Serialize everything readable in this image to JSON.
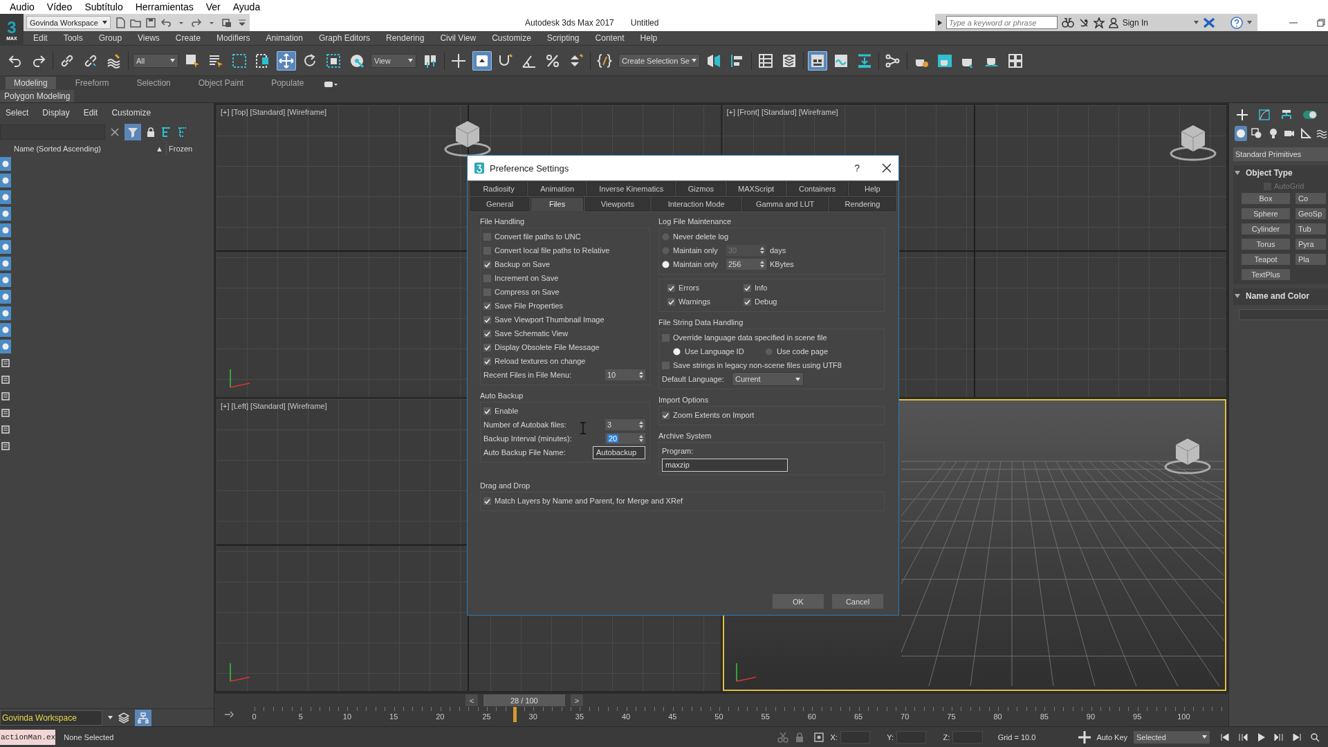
{
  "os_menu": [
    "Audio",
    "Vídeo",
    "Subtítulo",
    "Herramientas",
    "Ver",
    "Ayuda"
  ],
  "title_bar": {
    "logo_mark": "3",
    "logo_label": "MAX",
    "workspace": "Govinda Workspace",
    "app_title": "Autodesk 3ds Max 2017",
    "document": "Untitled",
    "search": {
      "placeholder": "Type a keyword or phrase"
    },
    "sign_in": "Sign In"
  },
  "menu_bar": [
    "Edit",
    "Tools",
    "Group",
    "Views",
    "Create",
    "Modifiers",
    "Animation",
    "Graph Editors",
    "Rendering",
    "Civil View",
    "Customize",
    "Scripting",
    "Content",
    "Help"
  ],
  "main_toolbar": {
    "selection_filter": "All",
    "reference_coordinate": "View",
    "named_selection": "Create Selection Se",
    "buttons": [
      {
        "selected": false
      },
      {
        "selected": false
      },
      {
        "selected": false
      },
      {
        "selected": false
      },
      {
        "selected": false
      },
      {
        "selected": false
      },
      {
        "selected": false
      },
      {
        "selected": false
      },
      {
        "selected": false
      },
      {
        "selected": true
      },
      {
        "selected": false
      },
      {
        "selected": false
      },
      {
        "selected": false
      },
      {
        "selected": false
      },
      {
        "selected": false
      },
      {
        "selected": true
      },
      {
        "selected": false
      },
      {
        "selected": false
      },
      {
        "selected": false
      },
      {
        "selected": false
      },
      {
        "selected": false
      },
      {
        "selected": false
      },
      {
        "selected": false
      },
      {
        "selected": false
      },
      {
        "selected": false
      },
      {
        "selected": true
      },
      {
        "selected": false
      },
      {
        "selected": false
      },
      {
        "selected": false
      },
      {
        "selected": false
      },
      {
        "selected": false
      },
      {
        "selected": false
      },
      {
        "selected": false
      },
      {
        "selected": false
      }
    ]
  },
  "ribbon": {
    "tabs": [
      {
        "label": "Modeling",
        "selected": true
      },
      {
        "label": "Freeform",
        "selected": false
      },
      {
        "label": "Selection",
        "selected": false
      },
      {
        "label": "Object Paint",
        "selected": false
      },
      {
        "label": "Populate",
        "selected": false
      }
    ],
    "panel": "Polygon Modeling"
  },
  "scene_explorer": {
    "menu": [
      "Select",
      "Display",
      "Edit",
      "Customize"
    ],
    "columns": [
      "Name (Sorted Ascending)",
      "Frozen"
    ],
    "sort_mark": "▲",
    "filters": [
      {
        "on": true
      },
      {
        "on": true
      },
      {
        "on": true
      },
      {
        "on": true
      },
      {
        "on": true
      },
      {
        "on": true
      },
      {
        "on": true
      },
      {
        "on": true
      },
      {
        "on": true
      },
      {
        "on": true
      },
      {
        "on": true
      },
      {
        "on": true
      },
      {
        "on": false
      },
      {
        "on": false
      },
      {
        "on": false
      },
      {
        "on": false
      },
      {
        "on": false
      },
      {
        "on": false
      }
    ],
    "workspace": "Govinda Workspace"
  },
  "viewports": [
    {
      "label": "[+] [Top] [Standard] [Wireframe]",
      "active": false
    },
    {
      "label": "[+] [Front] [Standard] [Wireframe]",
      "active": false
    },
    {
      "label": "[+] [Left] [Standard] [Wireframe]",
      "active": false
    },
    {
      "active": true
    }
  ],
  "dialog": {
    "title": "Preference Settings",
    "help": "?",
    "tab_rows": [
      [
        {
          "label": "Radiosity",
          "selected": false
        },
        {
          "label": "Animation",
          "selected": false
        },
        {
          "label": "Inverse Kinematics",
          "selected": false
        },
        {
          "label": "Gizmos",
          "selected": false
        },
        {
          "label": "MAXScript",
          "selected": false
        },
        {
          "label": "Containers",
          "selected": false
        },
        {
          "label": "Help",
          "selected": false
        }
      ],
      [
        {
          "label": "General",
          "selected": false
        },
        {
          "label": "Files",
          "selected": true
        },
        {
          "label": "Viewports",
          "selected": false
        },
        {
          "label": "Interaction Mode",
          "selected": false
        },
        {
          "label": "Gamma and LUT",
          "selected": false
        },
        {
          "label": "Rendering",
          "selected": false
        }
      ]
    ],
    "file_handling": {
      "title": "File Handling",
      "items": [
        {
          "label": "Convert file paths to UNC",
          "checked": false
        },
        {
          "label": "Convert local file paths to Relative",
          "checked": false
        },
        {
          "label": "Backup on Save",
          "checked": true
        },
        {
          "label": "Increment on Save",
          "checked": false
        },
        {
          "label": "Compress on Save",
          "checked": false
        },
        {
          "label": "Save File Properties",
          "checked": true
        },
        {
          "label": "Save Viewport Thumbnail Image",
          "checked": true
        },
        {
          "label": "Save Schematic View",
          "checked": true
        },
        {
          "label": "Display Obsolete File Message",
          "checked": true
        },
        {
          "label": "Reload textures on change",
          "checked": true
        }
      ],
      "recent_files": {
        "label": "Recent Files in File Menu:",
        "value": "10"
      }
    },
    "auto_backup": {
      "title": "Auto Backup",
      "enable": {
        "label": "Enable",
        "checked": true
      },
      "fields": [
        {
          "kind": "spinner",
          "label": "Number of Autobak files:",
          "value": "3",
          "highlighted": false
        },
        {
          "kind": "spinner",
          "label": "Backup Interval (minutes):",
          "value": "20",
          "highlighted": true
        },
        {
          "kind": "text",
          "label": "Auto Backup File Name:",
          "value": "Autobackup",
          "highlighted": false
        }
      ]
    },
    "log_file_maintenance": {
      "title": "Log File Maintenance",
      "options": [
        {
          "label": "Never delete log",
          "selected": false
        },
        {
          "label": "Maintain only",
          "selected": false,
          "value": "30",
          "unit": "days",
          "disabled": true
        },
        {
          "label": "Maintain only",
          "selected": true,
          "value": "256",
          "unit": "KBytes",
          "disabled": false
        }
      ],
      "flags": [
        {
          "label": "Errors",
          "checked": true
        },
        {
          "label": "Info",
          "checked": true
        },
        {
          "label": "Warnings",
          "checked": true
        },
        {
          "label": "Debug",
          "checked": true
        }
      ]
    },
    "file_string_data_handling": {
      "title": "File String Data Handling",
      "override": {
        "label": "Override language data specified in scene file",
        "checked": false
      },
      "choices": [
        {
          "label": "Use Language ID",
          "selected": true
        },
        {
          "label": "Use code page",
          "selected": false
        }
      ],
      "utf8": {
        "label": "Save strings in legacy non-scene files using UTF8",
        "checked": false
      },
      "default_language": {
        "label": "Default Language:",
        "value": "Current"
      }
    },
    "import_options": {
      "title": "Import Options",
      "items": [
        {
          "label": "Zoom Extents on Import",
          "checked": true
        }
      ]
    },
    "archive_system": {
      "title": "Archive System",
      "program_label": "Program:",
      "program": "maxzip"
    },
    "drag_and_drop": {
      "title": "Drag and Drop",
      "items": [
        {
          "label": "Match Layers by Name and Parent, for Merge and XRef",
          "checked": true
        }
      ]
    },
    "buttons": [
      "OK",
      "Cancel"
    ]
  },
  "command_panel": {
    "categories": [
      {
        "selected": true
      },
      {
        "selected": false
      },
      {
        "selected": false
      },
      {
        "selected": false
      },
      {
        "selected": false
      },
      {
        "selected": false
      }
    ],
    "dropdown": "Standard Primitives",
    "rollouts": [
      {
        "title": "Object Type",
        "expanded": true,
        "autogrid": {
          "label": "AutoGrid",
          "checked": false,
          "disabled": true
        },
        "buttons": [
          "Box",
          "Co",
          "Sphere",
          "GeoSp",
          "Cylinder",
          "Tub",
          "Torus",
          "Pyra",
          "Teapot",
          "Pla",
          "TextPlus"
        ]
      },
      {
        "title": "Name and Color",
        "expanded": true
      }
    ]
  },
  "timeline": {
    "prev": "<",
    "readout": "28 / 100",
    "next": ">",
    "level": 0.28,
    "ruler": [
      "0",
      "5",
      "10",
      "15",
      "20",
      "25",
      "30",
      "35",
      "40",
      "45",
      "50",
      "55",
      "60",
      "65",
      "70",
      "75",
      "80",
      "85",
      "90",
      "95",
      "100"
    ]
  },
  "status_bar": {
    "listener": "actionMan.ex",
    "prompt": "None Selected",
    "x_label": "X:",
    "y_label": "Y:",
    "z_label": "Z:",
    "grid": "Grid = 10.0",
    "auto_key": "Auto Key",
    "key_filter": "Selected"
  }
}
